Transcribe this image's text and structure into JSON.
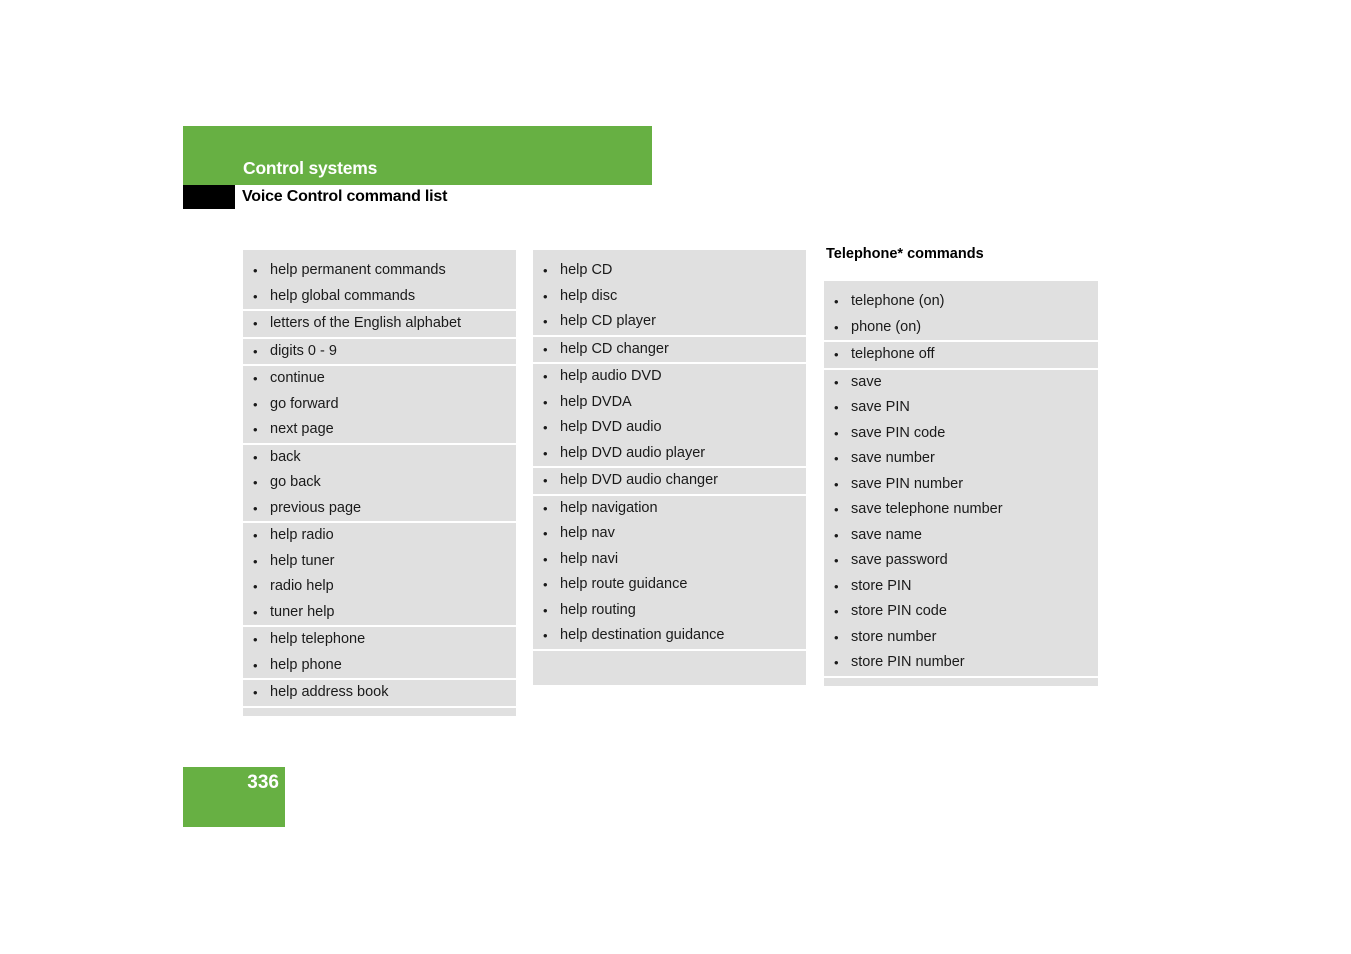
{
  "header": {
    "section_title": "Control systems",
    "page_subtitle": "Voice Control command list"
  },
  "columns": [
    {
      "id": "column-1",
      "heading": "",
      "groups": [
        {
          "items": [
            "help permanent commands",
            "help global commands"
          ]
        },
        {
          "items": [
            "letters of the English alphabet"
          ]
        },
        {
          "items": [
            "digits 0 - 9"
          ]
        },
        {
          "items": [
            "continue",
            "go forward",
            "next page"
          ]
        },
        {
          "items": [
            "back",
            "go back",
            "previous page"
          ]
        },
        {
          "items": [
            "help radio",
            "help tuner",
            "radio help",
            "tuner help"
          ]
        },
        {
          "items": [
            "help telephone",
            "help phone"
          ]
        },
        {
          "items": [
            "help address book"
          ]
        }
      ]
    },
    {
      "id": "column-2",
      "heading": "",
      "groups": [
        {
          "items": [
            "help CD",
            "help disc",
            "help CD player"
          ]
        },
        {
          "items": [
            "help CD changer"
          ]
        },
        {
          "items": [
            "help audio DVD",
            "help DVDA",
            "help DVD audio",
            "help DVD audio player"
          ]
        },
        {
          "items": [
            "help DVD audio changer"
          ]
        },
        {
          "items": [
            "help navigation",
            "help nav",
            "help navi",
            "help route guidance",
            "help routing",
            "help destination guidance"
          ]
        }
      ]
    },
    {
      "id": "column-3",
      "heading": "Telephone* commands",
      "groups": [
        {
          "items": [
            "telephone (on)",
            "phone (on)"
          ]
        },
        {
          "items": [
            "telephone off"
          ]
        },
        {
          "items": [
            "save",
            "save PIN",
            "save PIN code",
            "save number",
            "save PIN number",
            "save telephone number",
            "save name",
            "save password",
            "store PIN",
            "store PIN code",
            "store number",
            "store PIN number"
          ]
        }
      ]
    }
  ],
  "footer": {
    "page_number": "336"
  },
  "colors": {
    "brand_green": "#67b043",
    "list_gray": "#e0e0e0",
    "black_block": "#000000",
    "text": "#1a1a1a"
  }
}
